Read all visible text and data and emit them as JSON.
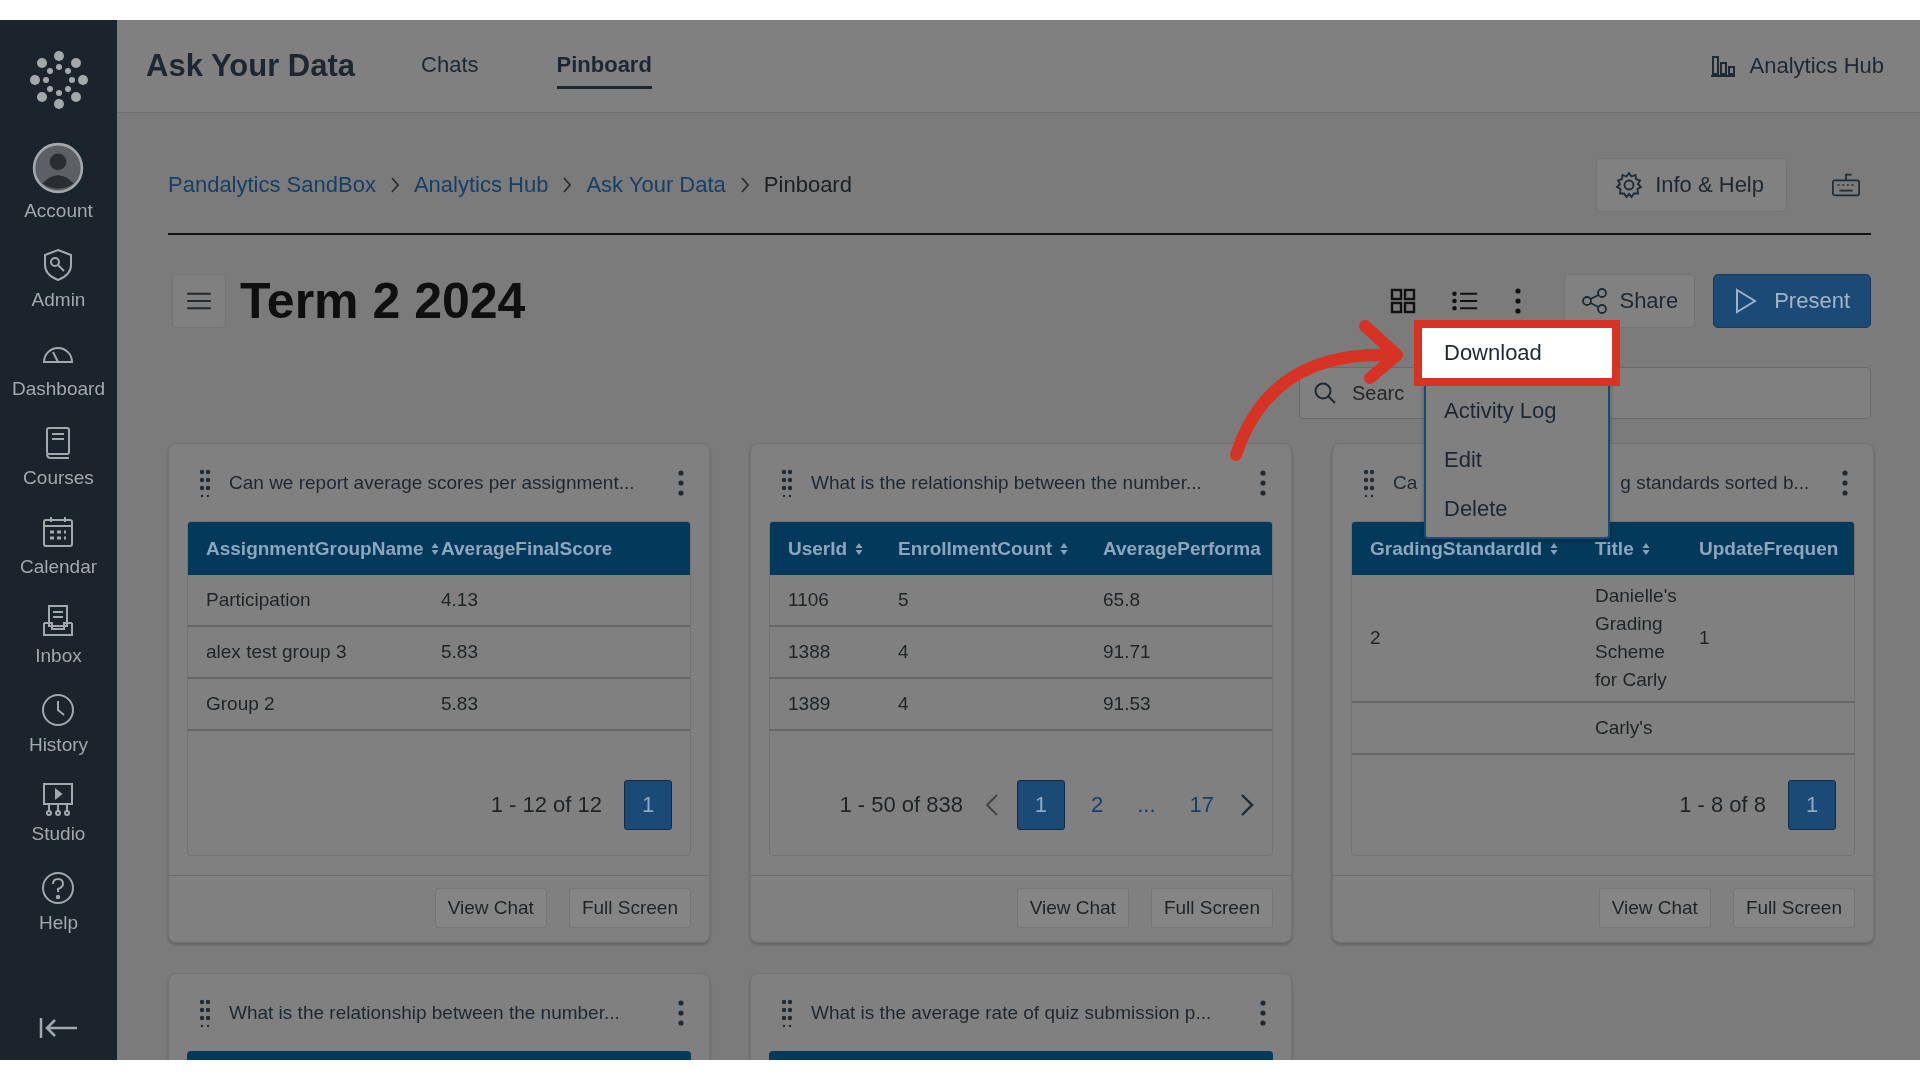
{
  "sidebar": {
    "items": [
      {
        "label": "Account"
      },
      {
        "label": "Admin"
      },
      {
        "label": "Dashboard"
      },
      {
        "label": "Courses"
      },
      {
        "label": "Calendar"
      },
      {
        "label": "Inbox"
      },
      {
        "label": "History"
      },
      {
        "label": "Studio"
      },
      {
        "label": "Help"
      }
    ]
  },
  "header": {
    "title": "Ask Your Data",
    "tabs": [
      {
        "label": "Chats",
        "selected": false
      },
      {
        "label": "Pinboard",
        "selected": true
      }
    ],
    "hub_link": "Analytics Hub"
  },
  "breadcrumb": [
    {
      "label": "Pandalytics SandBox",
      "link": true
    },
    {
      "label": "Analytics Hub",
      "link": true
    },
    {
      "label": "Ask Your Data",
      "link": true
    },
    {
      "label": "Pinboard",
      "link": false
    }
  ],
  "info_button": "Info & Help",
  "page_title": "Term 2 2024",
  "share_button": "Share",
  "present_button": "Present",
  "search": {
    "placeholder": "Searc"
  },
  "menu": [
    {
      "label": "Download",
      "highlighted": true
    },
    {
      "label": "Activity Log",
      "highlighted": false
    },
    {
      "label": "Edit",
      "highlighted": false
    },
    {
      "label": "Delete",
      "highlighted": false
    }
  ],
  "cards": [
    {
      "title": "Can we report average scores per assignment...",
      "columns": [
        "AssignmentGroupName",
        "AverageFinalScore"
      ],
      "rows": [
        [
          "Participation",
          "4.13"
        ],
        [
          "alex test group 3",
          "5.83"
        ],
        [
          "Group 2",
          "5.83"
        ]
      ],
      "pagination": {
        "summary": "1 - 12 of 12",
        "arrows": false,
        "pages": [
          {
            "label": "1",
            "selected": true
          }
        ]
      },
      "buttons": [
        "View Chat",
        "Full Screen"
      ]
    },
    {
      "title": "What is the relationship between the number...",
      "columns": [
        "UserId",
        "EnrollmentCount",
        "AveragePerforma"
      ],
      "rows": [
        [
          "1106",
          "5",
          "65.8"
        ],
        [
          "1388",
          "4",
          "91.71"
        ],
        [
          "1389",
          "4",
          "91.53"
        ]
      ],
      "pagination": {
        "summary": "1 - 50 of 838",
        "arrows": true,
        "pages": [
          {
            "label": "1",
            "selected": true
          },
          {
            "label": "2",
            "selected": false
          },
          {
            "label": "...",
            "selected": false
          },
          {
            "label": "17",
            "selected": false
          }
        ]
      },
      "buttons": [
        "View Chat",
        "Full Screen"
      ]
    },
    {
      "title": "Ca",
      "title_end": "g standards sorted b...",
      "columns": [
        "GradingStandardId",
        "Title",
        "UpdateFrequen"
      ],
      "rows": [
        [
          "2",
          "Danielle's Grading Scheme for Carly",
          "1"
        ],
        [
          null,
          "Carly's",
          null
        ]
      ],
      "pagination": {
        "summary": "1 - 8 of 8",
        "arrows": false,
        "pages": [
          {
            "label": "1",
            "selected": true
          }
        ]
      },
      "buttons": [
        "View Chat",
        "Full Screen"
      ]
    },
    {
      "title": "What is the relationship between the number..."
    },
    {
      "title": "What is the average rate of quiz submission p..."
    }
  ]
}
